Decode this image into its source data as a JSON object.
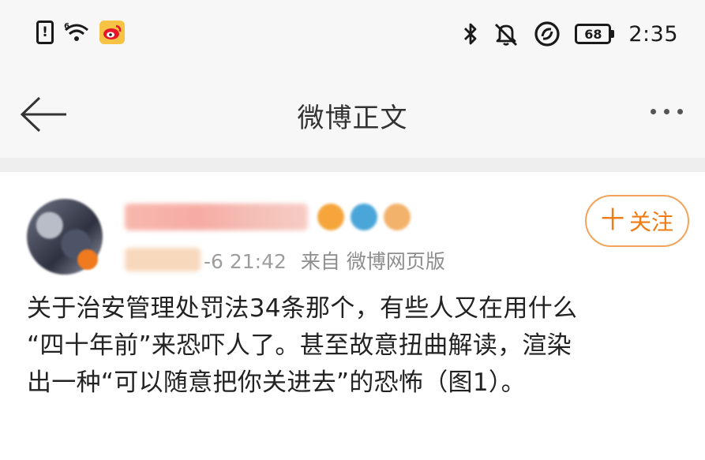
{
  "status_bar": {
    "sim_label": "!",
    "wifi_badge": "6",
    "battery_level": "68",
    "time": "2:35",
    "icons": [
      "sim-alert-icon",
      "wifi-6-icon",
      "weibo-app-icon",
      "bluetooth-icon",
      "mute-icon",
      "ring-icon",
      "battery-icon"
    ]
  },
  "nav": {
    "title": "微博正文"
  },
  "post": {
    "author": {
      "follow_label": "关注",
      "follow_prefix": "十"
    },
    "time": "-6 21:42",
    "source": "来自 微博网页版",
    "text": "关于治安管理处罚法34条那个，有些人又在用什么\n“四十年前”来恐吓人了。甚至故意扭曲解读，渲染\n出一种“可以随意把你关进去”的恐怖（图1）。"
  },
  "colors": {
    "accent": "#f07b13",
    "follow_border": "#f4a35a",
    "meta_text": "#8d8d8d",
    "bar_bg": "#f7f7f7"
  }
}
